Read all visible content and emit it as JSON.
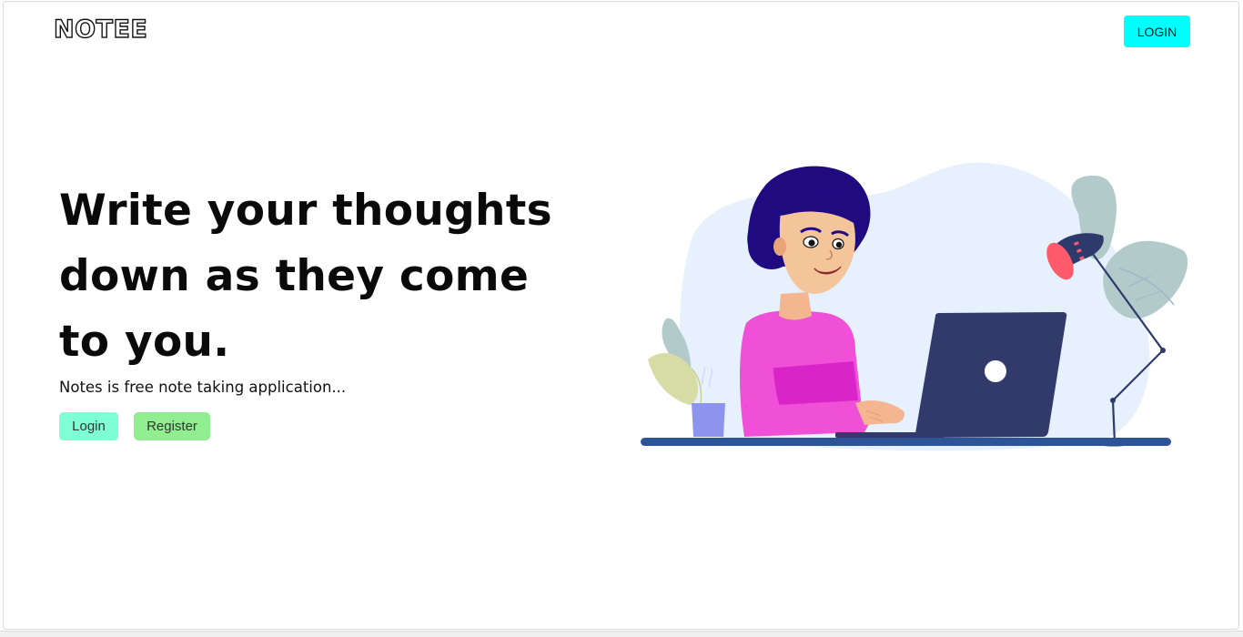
{
  "header": {
    "logo_text": "NOTEE",
    "login_label": "LOGIN"
  },
  "hero": {
    "title": "Write your thoughts down as they come to you.",
    "subtitle": "Notes is free note taking application...",
    "login_label": "Login",
    "register_label": "Register"
  },
  "illustration": {
    "icon": "woman-typing-on-laptop-illustration"
  },
  "colors": {
    "header_login_bg": "#00ffff",
    "hero_login_bg": "#7fffd4",
    "hero_register_bg": "#90ee90",
    "blob_bg": "#e6f1fd",
    "laptop": "#323a6b",
    "shirt": "#f04fd8",
    "desk": "#2d5496"
  }
}
